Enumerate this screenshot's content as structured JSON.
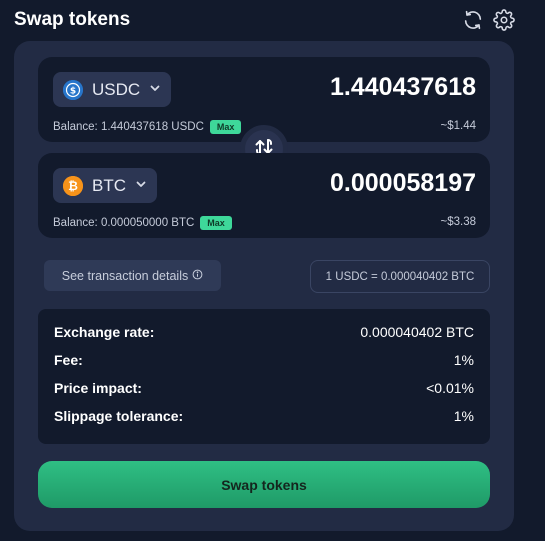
{
  "header": {
    "title": "Swap tokens",
    "refresh_icon": "refresh-icon",
    "settings_icon": "gear-icon"
  },
  "from": {
    "symbol": "USDC",
    "amount": "1.440437618",
    "balance_label": "Balance: 1.440437618 USDC",
    "max_label": "Max",
    "usd_value": "~$1.44",
    "coin_color": "#2775ca"
  },
  "to": {
    "symbol": "BTC",
    "amount": "0.000058197",
    "balance_label": "Balance: 0.000050000 BTC",
    "max_label": "Max",
    "usd_value": "~$3.38",
    "coin_color": "#f7931a"
  },
  "details_button_label": "See transaction details",
  "rate_pill": "1 USDC = 0.000040402 BTC",
  "summary": {
    "rows": [
      {
        "label": "Exchange rate:",
        "value": "0.000040402 BTC"
      },
      {
        "label": "Fee:",
        "value": "1%"
      },
      {
        "label": "Price impact:",
        "value": "<0.01%"
      },
      {
        "label": "Slippage tolerance:",
        "value": "1%"
      }
    ]
  },
  "primary_button_label": "Swap tokens",
  "colors": {
    "accent_green": "#2fbf84",
    "max_badge": "#3ed89a",
    "background": "#121a2c",
    "card": "#222b44"
  }
}
